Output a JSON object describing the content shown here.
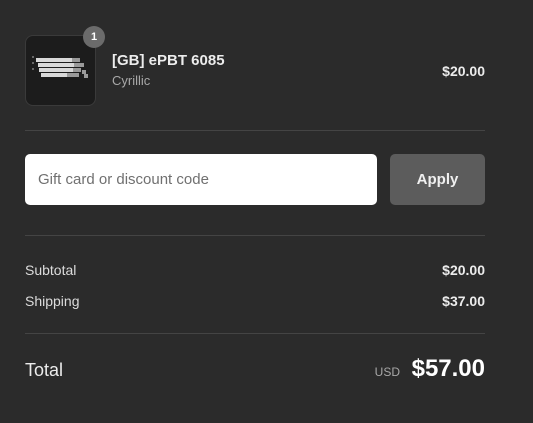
{
  "cart": {
    "item": {
      "quantity": "1",
      "name": "[GB] ePBT 6085",
      "variant": "Cyrillic",
      "price": "$20.00",
      "thumbnail": "keycap-set-image"
    }
  },
  "discount": {
    "placeholder": "Gift card or discount code",
    "apply_label": "Apply"
  },
  "summary": {
    "subtotal_label": "Subtotal",
    "subtotal_value": "$20.00",
    "shipping_label": "Shipping",
    "shipping_value": "$37.00",
    "total_label": "Total",
    "currency": "USD",
    "total_value": "$57.00"
  },
  "colors": {
    "background": "#2b2b2b",
    "apply_button": "#5c5c5c",
    "badge": "#6b6b6b"
  }
}
